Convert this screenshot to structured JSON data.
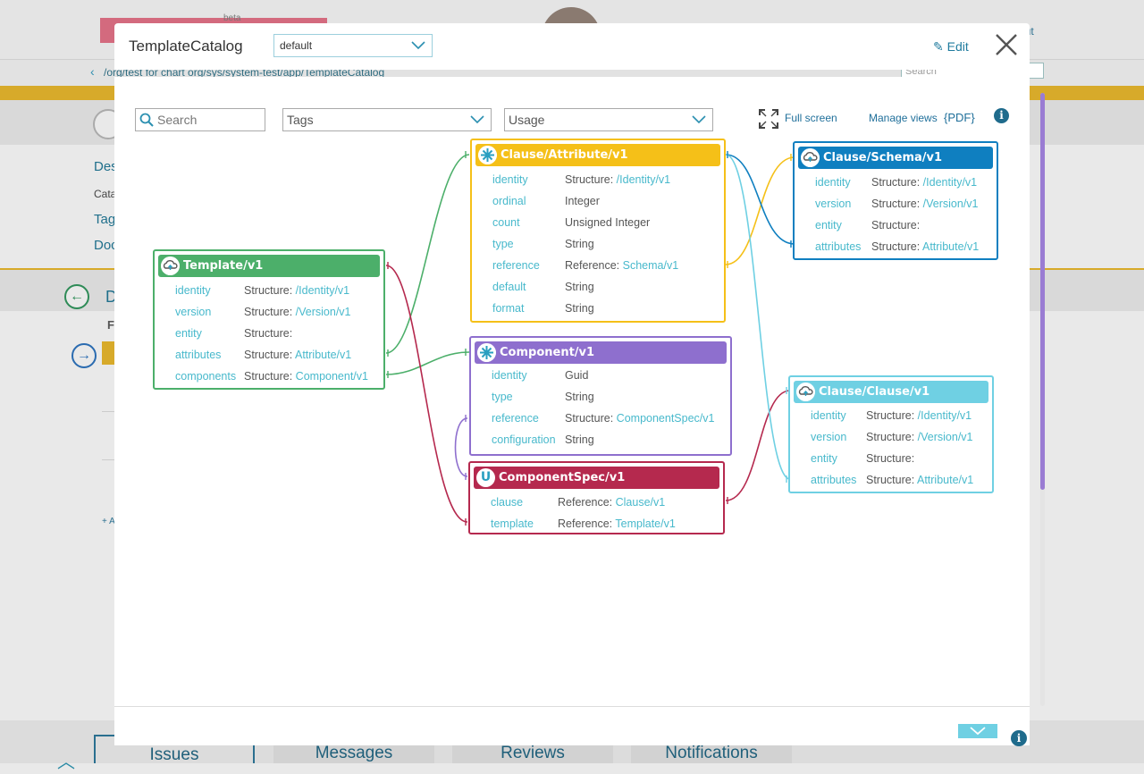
{
  "background": {
    "beta_label": "beta",
    "logout_label": "out",
    "breadcrumb": "/org/test for chart org/sys/system-test/app/TemplateCatalog",
    "search_placeholder": "Search",
    "side_labels": [
      "Des",
      "Cata",
      "Tag",
      "Doc"
    ],
    "section_letter": "D",
    "row_letter": "F",
    "add_label": "+ A",
    "tabs": [
      "Issues",
      "Messages",
      "Reviews",
      "Notifications"
    ]
  },
  "modal": {
    "title": "TemplateCatalog",
    "view_selected": "default",
    "edit_label": "Edit"
  },
  "toolbar": {
    "search_placeholder": "Search",
    "tags_label": "Tags",
    "usage_label": "Usage",
    "fullscreen_label": "Full screen",
    "manage_views_label": "Manage views",
    "pdf_label": "{PDF}"
  },
  "colors": {
    "template": "#4caf6a",
    "attribute": "#f5c018",
    "schema": "#0f7fc0",
    "component": "#8e6fce",
    "componentspec": "#b5294e",
    "clause": "#6fd0e3"
  },
  "entities": {
    "attribute": {
      "title": "Clause/Attribute/v1",
      "icon": "flower-icon",
      "fields": [
        {
          "name": "identity",
          "type": "Structure: ",
          "ref": "/Identity/v1"
        },
        {
          "name": "ordinal",
          "type": "Integer",
          "ref": ""
        },
        {
          "name": "count",
          "type": "Unsigned Integer",
          "ref": ""
        },
        {
          "name": "type",
          "type": "String",
          "ref": ""
        },
        {
          "name": "reference",
          "type": "Reference: ",
          "ref": "Schema/v1"
        },
        {
          "name": "default",
          "type": "String",
          "ref": ""
        },
        {
          "name": "format",
          "type": "String",
          "ref": ""
        }
      ]
    },
    "schema": {
      "title": "Clause/Schema/v1",
      "icon": "cloud-icon",
      "fields": [
        {
          "name": "identity",
          "type": "Structure: ",
          "ref": "/Identity/v1"
        },
        {
          "name": "version",
          "type": "Structure: ",
          "ref": "/Version/v1"
        },
        {
          "name": "entity",
          "type": "Structure:",
          "ref": ""
        },
        {
          "name": "attributes",
          "type": "Structure: ",
          "ref": "Attribute/v1"
        }
      ]
    },
    "template": {
      "title": "Template/v1",
      "icon": "cloud-icon",
      "fields": [
        {
          "name": "identity",
          "type": "Structure: ",
          "ref": "/Identity/v1"
        },
        {
          "name": "version",
          "type": "Structure: ",
          "ref": "/Version/v1"
        },
        {
          "name": "entity",
          "type": "Structure:",
          "ref": ""
        },
        {
          "name": "attributes",
          "type": "Structure: ",
          "ref": "Attribute/v1"
        },
        {
          "name": "components",
          "type": "Structure: ",
          "ref": "Component/v1"
        }
      ]
    },
    "component": {
      "title": "Component/v1",
      "icon": "flower-icon",
      "fields": [
        {
          "name": "identity",
          "type": "Guid",
          "ref": ""
        },
        {
          "name": "type",
          "type": "String",
          "ref": ""
        },
        {
          "name": "reference",
          "type": "Structure: ",
          "ref": "ComponentSpec/v1"
        },
        {
          "name": "configuration",
          "type": "String",
          "ref": ""
        }
      ]
    },
    "componentspec": {
      "title": "ComponentSpec/v1",
      "icon": "u-icon",
      "icon_letter": "U",
      "fields": [
        {
          "name": "clause",
          "type": "Reference: ",
          "ref": "Clause/v1"
        },
        {
          "name": "template",
          "type": "Reference: ",
          "ref": "Template/v1"
        }
      ]
    },
    "clause": {
      "title": "Clause/Clause/v1",
      "icon": "cloud-icon",
      "fields": [
        {
          "name": "identity",
          "type": "Structure: ",
          "ref": "/Identity/v1"
        },
        {
          "name": "version",
          "type": "Structure: ",
          "ref": "/Version/v1"
        },
        {
          "name": "entity",
          "type": "Structure:",
          "ref": ""
        },
        {
          "name": "attributes",
          "type": "Structure: ",
          "ref": "Attribute/v1"
        }
      ]
    }
  }
}
